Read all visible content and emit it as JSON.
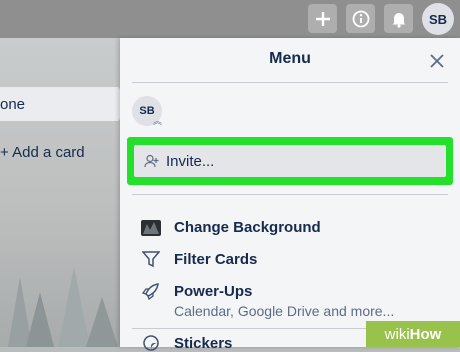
{
  "topbar": {
    "buttons": [
      "add-icon",
      "info-icon",
      "bell-icon"
    ],
    "avatar": "SB"
  },
  "board": {
    "card_text": "one",
    "add_card": "+ Add a card"
  },
  "menu": {
    "title": "Menu",
    "member_initials": "SB",
    "invite": "Invite...",
    "items": [
      {
        "label": "Change Background",
        "icon": "background-image-icon"
      },
      {
        "label": "Filter Cards",
        "icon": "filter-icon"
      },
      {
        "label": "Power-Ups",
        "icon": "rocket-icon",
        "sub": "Calendar, Google Drive and more..."
      },
      {
        "label": "Stickers",
        "icon": "sticker-icon"
      }
    ],
    "highlight_color": "#25e02b"
  },
  "watermark": {
    "prefix": "wiki",
    "suffix": "How"
  }
}
